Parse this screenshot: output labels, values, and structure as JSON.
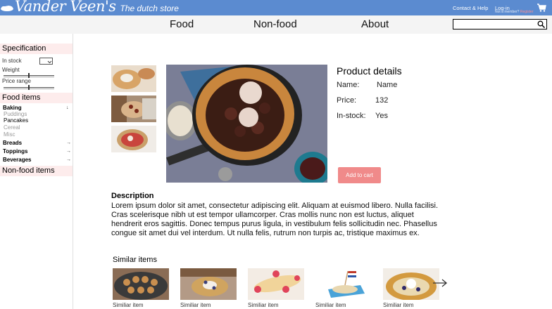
{
  "header": {
    "brand": "Vander Veen's",
    "tagline": "The dutch store",
    "contact": "Contact & Help",
    "login": "Log-in",
    "member_prefix": "Not a member? ",
    "register": "Register",
    "bar_color": "#5b8bd0"
  },
  "nav": {
    "items": [
      "Food",
      "Non-food",
      "About"
    ],
    "search_placeholder": ""
  },
  "sidebar": {
    "specification": "Specification",
    "in_stock": "In stock",
    "weight": "Weight",
    "price_range": "Price range",
    "food_items": "Food items",
    "categories": [
      {
        "label": "Baking",
        "subitems": [
          {
            "label": "Puddings",
            "active": false
          },
          {
            "label": "Pancakes",
            "active": true
          },
          {
            "label": "Cereal",
            "active": false
          },
          {
            "label": "Misc",
            "active": false
          }
        ]
      },
      {
        "label": "Breads"
      },
      {
        "label": "Toppings"
      },
      {
        "label": "Beverages"
      }
    ],
    "non_food_items": "Non-food items",
    "weight_level": 0.5,
    "price_level": 0.5
  },
  "product": {
    "details_title": "Product details",
    "name_label": "Name:",
    "name_value": "Name",
    "price_label": "Price:",
    "price_value": "132",
    "stock_label": "In-stock:",
    "stock_value": "Yes",
    "add_to_cart": "Add to cart",
    "accent_color": "#f08a8a"
  },
  "description": {
    "title": "Description",
    "body": "Lorem ipsum dolor sit amet, consectetur adipiscing elit. Aliquam at euismod libero. Nulla facilisi. Cras scelerisque nibh ut est tempor ullamcorper. Cras mollis nunc non est luctus, aliquet hendrerit eros sagittis. Donec tempus purus ligula, in vestibulum felis sollicitudin nec. Phasellus congue sit amet dui vel interdum. Ut nulla felis, rutrum non turpis ac, tristique maximus ex."
  },
  "similar": {
    "title": "Similar items",
    "items": [
      {
        "caption": "Similiar item"
      },
      {
        "caption": "Similiar item"
      },
      {
        "caption": "Similiar item"
      },
      {
        "caption": "Similiar item"
      },
      {
        "caption": "Similiar item"
      }
    ]
  }
}
